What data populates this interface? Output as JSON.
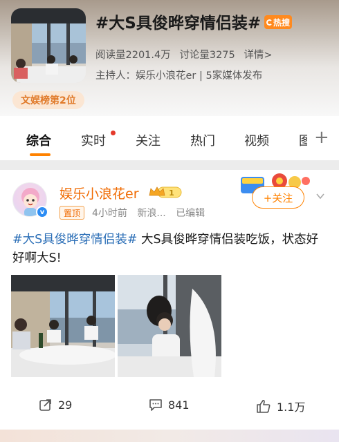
{
  "topic": {
    "title": "#大S具俊晔穿情侣装#",
    "hot_badge": "热搜",
    "read_count": "阅读量2201.4万",
    "discussion_count": "讨论量3275",
    "details_link": "详情>",
    "host_line": "主持人：娱乐小浪花er | 5家媒体发布",
    "rank_tag": "文娱榜第2位"
  },
  "tabs": [
    {
      "label": "综合",
      "active": true
    },
    {
      "label": "实时",
      "has_dot": true
    },
    {
      "label": "关注"
    },
    {
      "label": "热门"
    },
    {
      "label": "视频"
    },
    {
      "label": "图"
    }
  ],
  "post": {
    "author": "娱乐小浪花er",
    "level_badge": "1",
    "pin_label": "置顶",
    "time": "4小时前",
    "source": "新浪...",
    "edited": "已编辑",
    "follow_label": "+关注",
    "hashtag": "#大S具俊晔穿情侣装#",
    "body": " 大S具俊晔穿情侣装吃饭，状态好好啊大S!",
    "reposts": "29",
    "comments": "841",
    "likes": "1.1万"
  },
  "colors": {
    "accent": "#ff8200",
    "author_orange": "#f06a00",
    "hashtag_blue": "#2c6fb7",
    "hot_badge": "#ff8a1f"
  },
  "icons": [
    "hot-icon",
    "verified-icon",
    "crown-icon",
    "plus-icon",
    "chevron-down-icon",
    "repost-icon",
    "comment-icon",
    "like-icon"
  ]
}
